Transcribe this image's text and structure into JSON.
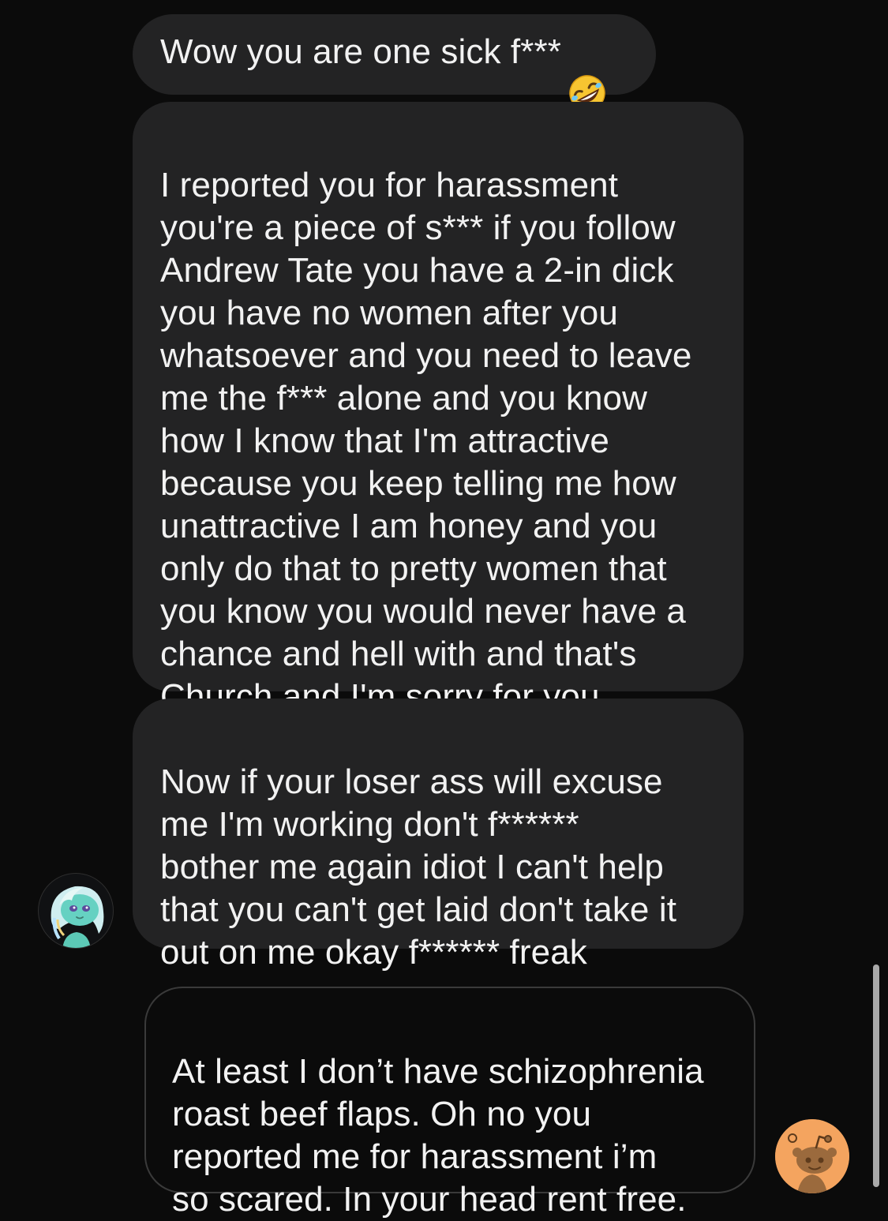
{
  "conversation": {
    "messages": [
      {
        "sender": "them",
        "text": "Wow you are one sick f***",
        "emoji": "rolling-on-floor-laughing"
      },
      {
        "sender": "them",
        "text": "I reported you for harassment\nyou're a piece of s*** if you follow\nAndrew Tate you have a 2-in dick\nyou have no women after you\nwhatsoever and you need to leave\nme the f*** alone and you know\nhow I know that I'm attractive\nbecause you keep telling me how\nunattractive I am honey and you\nonly do that to pretty women that\nyou know you would never have a\nchance and hell with and that's\nChurch and I'm sorry for you"
      },
      {
        "sender": "them",
        "text": "Now if your loser ass will excuse\nme I'm working don't f******\nbother me again idiot I can't help\nthat you can't get laid don't take it\nout on me okay f****** freak"
      },
      {
        "sender": "me",
        "text": "At least I don’t have schizophrenia\nroast beef flaps. Oh no you\nreported me for harassment i’m\nso scared. In your head rent free."
      }
    ]
  },
  "avatars": {
    "them": {
      "icon": "teal-snoo-avatar-icon",
      "color": "#66d1c2"
    },
    "me": {
      "icon": "orange-snoo-avatar-icon",
      "color": "#f4a45f"
    }
  },
  "colors": {
    "background": "#0b0b0b",
    "incoming_bubble": "#232324",
    "outgoing_border": "#3a3a3a",
    "text": "#f2f2f2"
  }
}
